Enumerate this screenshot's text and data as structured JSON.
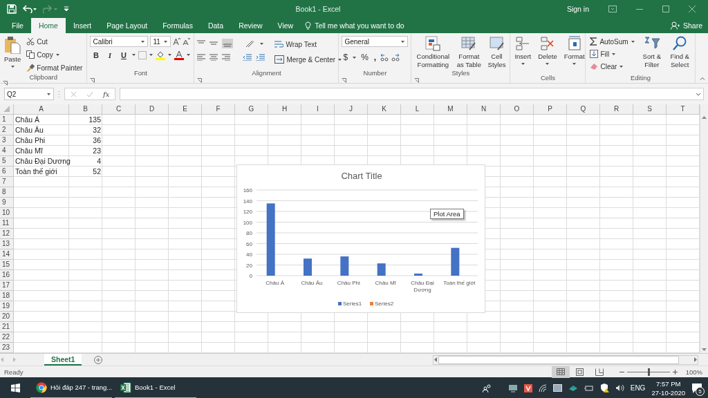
{
  "title_bar": {
    "title": "Book1  -  Excel",
    "sign_in": "Sign in"
  },
  "ribbon_tabs": [
    {
      "label": "File",
      "selected": false
    },
    {
      "label": "Home",
      "selected": true
    },
    {
      "label": "Insert",
      "selected": false
    },
    {
      "label": "Page Layout",
      "selected": false
    },
    {
      "label": "Formulas",
      "selected": false
    },
    {
      "label": "Data",
      "selected": false
    },
    {
      "label": "Review",
      "selected": false
    },
    {
      "label": "View",
      "selected": false
    }
  ],
  "tell_me": {
    "placeholder": "Tell me what you want to do"
  },
  "share": "Share",
  "ribbon": {
    "clipboard": {
      "paste": "Paste",
      "cut": "Cut",
      "copy": "Copy",
      "format_painter": "Format Painter",
      "label": "Clipboard"
    },
    "font": {
      "name": "Calibri",
      "size": "11",
      "bold": "B",
      "italic": "I",
      "underline": "U",
      "label": "Font"
    },
    "alignment": {
      "wrap_text": "Wrap Text",
      "merge_center": "Merge & Center",
      "label": "Alignment"
    },
    "number": {
      "format": "General",
      "currency": "$",
      "percent": "%",
      "comma": ",",
      "label": "Number"
    },
    "styles": {
      "buttons": [
        "Conditional Formatting",
        "Format as Table",
        "Cell Styles"
      ],
      "label": "Styles"
    },
    "cells": {
      "buttons": [
        "Insert",
        "Delete",
        "Format"
      ],
      "label": "Cells"
    },
    "editing": {
      "autosum": "AutoSum",
      "fill": "Fill",
      "clear": "Clear",
      "buttons": [
        "Sort & Filter",
        "Find & Select"
      ],
      "label": "Editing"
    }
  },
  "formula_bar": {
    "name_box": "Q2",
    "fx": "fx"
  },
  "sheet": {
    "columns": [
      "A",
      "B",
      "C",
      "D",
      "E",
      "F",
      "G",
      "H",
      "I",
      "J",
      "K",
      "L",
      "M",
      "N",
      "O",
      "P",
      "Q",
      "R",
      "S",
      "T"
    ],
    "rows": [
      {
        "header": "1",
        "cells": [
          "Châu Á",
          "135"
        ]
      },
      {
        "header": "2",
        "cells": [
          "Châu Âu",
          "32"
        ]
      },
      {
        "header": "3",
        "cells": [
          "Châu Phi",
          "36"
        ]
      },
      {
        "header": "4",
        "cells": [
          "Châu Mĩ",
          "23"
        ]
      },
      {
        "header": "5",
        "cells": [
          "Châu Đại Dương",
          "4"
        ]
      },
      {
        "header": "6",
        "cells": [
          "Toàn thế giới",
          "52"
        ]
      },
      {
        "header": "7"
      },
      {
        "header": "8"
      },
      {
        "header": "9"
      },
      {
        "header": "10"
      },
      {
        "header": "11"
      },
      {
        "header": "12"
      },
      {
        "header": "13"
      },
      {
        "header": "14"
      },
      {
        "header": "15"
      },
      {
        "header": "16"
      },
      {
        "header": "17"
      },
      {
        "header": "18"
      },
      {
        "header": "19"
      },
      {
        "header": "20"
      },
      {
        "header": "21"
      },
      {
        "header": "22"
      },
      {
        "header": "23"
      }
    ]
  },
  "chart": {
    "tooltip": "Plot Area",
    "chart_data": {
      "type": "bar",
      "title": "Chart Title",
      "categories": [
        "Châu Á",
        "Châu Âu",
        "Châu Phi",
        "Châu Mĩ",
        "Châu Đại Dương",
        "Toàn thế giới"
      ],
      "series": [
        {
          "name": "Series1",
          "color": "#4472c4",
          "values": [
            135,
            32,
            36,
            23,
            4,
            52
          ]
        },
        {
          "name": "Series2",
          "color": "#ed7d31",
          "values": [
            null,
            null,
            null,
            null,
            null,
            null
          ]
        }
      ],
      "grid": true,
      "ylim": [
        0,
        160
      ],
      "yticks": [
        0,
        20,
        40,
        60,
        80,
        100,
        120,
        140,
        160
      ]
    }
  },
  "sheet_tabs": [
    {
      "label": "Sheet1",
      "selected": true
    }
  ],
  "status_bar": {
    "status": "Ready",
    "views": [
      {
        "kind": "normal",
        "selected": true
      },
      {
        "kind": "page_layout",
        "selected": false
      },
      {
        "kind": "page_break",
        "selected": false
      }
    ],
    "zoom": {
      "level": 0.5
    },
    "zoom_reading": "100%"
  },
  "taskbar": {
    "apps": [
      {
        "kind": "browser",
        "label": "Hỏi đáp 247 - trang..."
      },
      {
        "kind": "excel",
        "label": "Book1 - Excel"
      }
    ],
    "language": "ENG",
    "time": "7:57 PM",
    "date": "27-10-2020",
    "notifications": "5"
  }
}
